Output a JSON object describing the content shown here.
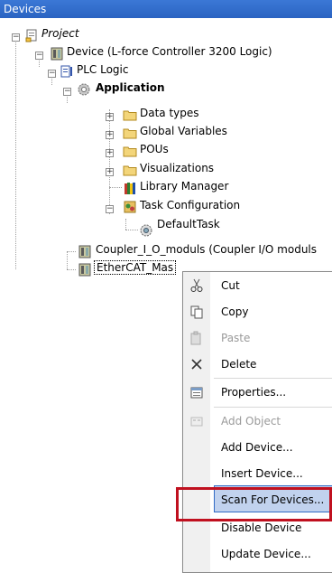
{
  "panel": {
    "title": "Devices"
  },
  "tree": {
    "project": "Project",
    "device": "Device (L-force Controller 3200 Logic)",
    "plc_logic": "PLC Logic",
    "application": "Application",
    "data_types": "Data types",
    "global_variables": "Global Variables",
    "pous": "POUs",
    "visualizations": "Visualizations",
    "library_manager": "Library Manager",
    "task_configuration": "Task Configuration",
    "default_task": "DefaultTask",
    "coupler": "Coupler_I_O_moduls (Coupler I/O moduls",
    "ethercat": "EtherCAT_Master (EtherCAT_Master)",
    "ethercat_visible": "EtherCAT_Mas"
  },
  "context_menu": {
    "items": [
      {
        "label": "Cut",
        "icon": "scissors-icon",
        "enabled": true
      },
      {
        "label": "Copy",
        "icon": "copy-icon",
        "enabled": true
      },
      {
        "label": "Paste",
        "icon": "paste-icon",
        "enabled": false
      },
      {
        "label": "Delete",
        "icon": "delete-x-icon",
        "enabled": true
      },
      {
        "label": "Properties...",
        "icon": "properties-icon",
        "enabled": true
      },
      {
        "label": "Add Object",
        "icon": "add-object-icon",
        "enabled": false
      },
      {
        "label": "Add Device...",
        "icon": "",
        "enabled": true
      },
      {
        "label": "Insert Device...",
        "icon": "",
        "enabled": true
      },
      {
        "label": "Scan For Devices...",
        "icon": "",
        "enabled": true,
        "highlighted": true
      },
      {
        "label": "Disable Device",
        "icon": "",
        "enabled": true
      },
      {
        "label": "Update Device...",
        "icon": "",
        "enabled": true
      }
    ]
  },
  "colors": {
    "highlight_box": "#c0101f",
    "title_bar": "#2a63c2",
    "menu_hover": "#c1d2ee"
  }
}
